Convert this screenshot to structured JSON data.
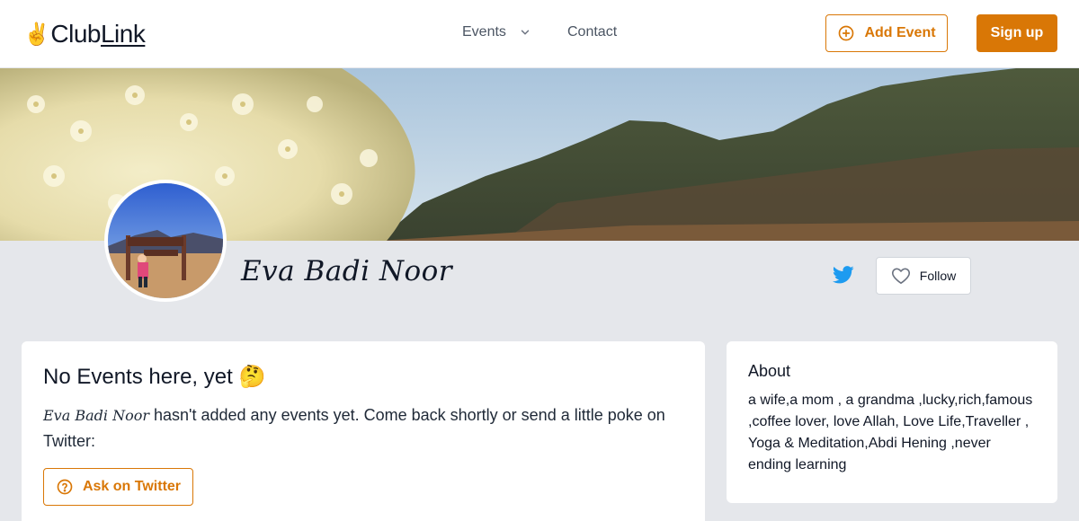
{
  "brand": {
    "emoji": "✌️",
    "name_part1": "Club",
    "name_part2": "Link"
  },
  "nav": {
    "events_label": "Events",
    "contact_label": "Contact"
  },
  "header_buttons": {
    "add_event_label": "Add Event",
    "signup_label": "Sign up"
  },
  "profile": {
    "name": "Eva Badi Noor",
    "follow_label": "Follow"
  },
  "events_card": {
    "title": "No Events here, yet 🤔",
    "message_name": "Eva Badi Noor",
    "message_rest": "hasn't added any events yet. Come back shortly or send a little poke on Twitter:",
    "ask_button_label": "Ask on Twitter"
  },
  "about_card": {
    "title": "About",
    "text": "a wife,a mom , a grandma ,lucky,rich,famous ,coffee lover, love Allah, Love Life,Traveller , Yoga & Meditation,Abdi Hening ,never ending learning"
  },
  "colors": {
    "accent": "#d97706",
    "twitter": "#1d9bf0",
    "page_bg": "#e5e7eb"
  }
}
